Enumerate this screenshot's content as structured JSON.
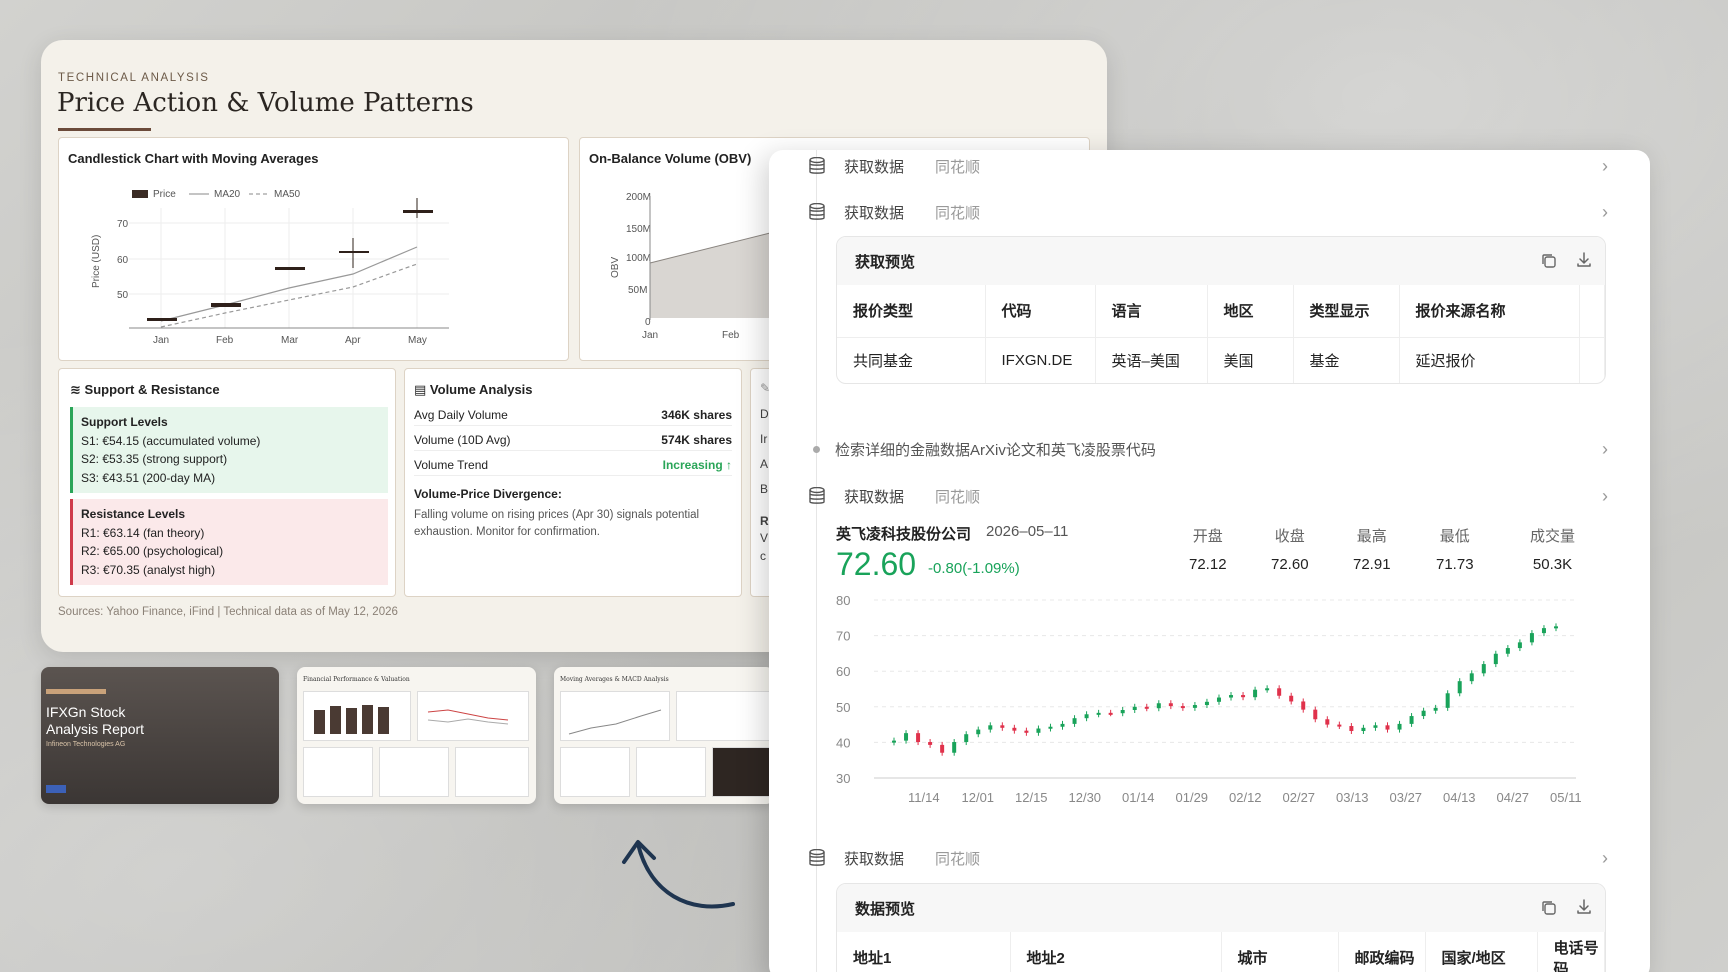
{
  "report": {
    "kicker": "TECHNICAL ANALYSIS",
    "title": "Price Action & Volume Patterns",
    "candle_title": "Candlestick Chart with Moving Averages",
    "obv_title": "On-Balance Volume (OBV)",
    "legend": [
      "Price",
      "MA20",
      "MA50"
    ],
    "candle_ylabel": "Price (USD)",
    "candle_yticks": [
      "70",
      "60",
      "50"
    ],
    "candle_xticks": [
      "Jan",
      "Feb",
      "Mar",
      "Apr",
      "May"
    ],
    "obv_ylabel": "OBV",
    "obv_yticks": [
      "200M",
      "150M",
      "100M",
      "50M",
      "0"
    ],
    "obv_xticks": [
      "Jan",
      "Feb"
    ],
    "sr": {
      "title": "Support & Resistance",
      "support_head": "Support Levels",
      "support": [
        "S1: €54.15 (accumulated volume)",
        "S2: €53.35 (strong support)",
        "S3: €43.51 (200-day MA)"
      ],
      "resist_head": "Resistance Levels",
      "resist": [
        "R1: €63.14 (fan theory)",
        "R2: €65.00 (psychological)",
        "R3: €70.35 (analyst high)"
      ]
    },
    "vol": {
      "title": "Volume Analysis",
      "rows": [
        {
          "k": "Avg Daily Volume",
          "v": "346K shares"
        },
        {
          "k": "Volume (10D Avg)",
          "v": "574K shares"
        },
        {
          "k": "Volume Trend",
          "v": "Increasing ↑"
        }
      ],
      "div_title": "Volume-Price Divergence:",
      "div_text": "Falling volume on rising prices (Apr 30) signals potential exhaustion. Monitor for confirmation."
    },
    "extra_letters": [
      "D",
      "Ir",
      "A",
      "B",
      "R",
      "V",
      "c"
    ],
    "sources": "Sources: Yahoo Finance, iFind | Technical data as of May 12, 2026"
  },
  "thumbs": {
    "t1_title": "IFXGn Stock Analysis Report",
    "t1_sub": "Infineon Technologies AG",
    "t2_title": "Financial Performance & Valuation",
    "t3_title": "Moving Averages & MACD Analysis"
  },
  "right": {
    "steps": [
      {
        "label": "获取数据",
        "source": "同花顺"
      },
      {
        "label": "获取数据",
        "source": "同花顺"
      },
      {
        "label": "获取数据",
        "source": "同花顺"
      },
      {
        "label": "获取数据",
        "source": "同花顺"
      }
    ],
    "bullet": "检索详细的金融数据ArXiv论文和英飞凌股票代码",
    "preview1": {
      "title": "获取预览",
      "headers": [
        "报价类型",
        "代码",
        "语言",
        "地区",
        "类型显示",
        "报价来源名称"
      ],
      "row": [
        "共同基金",
        "IFXGN.DE",
        "英语–美国",
        "美国",
        "基金",
        "延迟报价"
      ]
    },
    "stock": {
      "name": "英飞凌科技股份公司",
      "date": "2026–05–11",
      "price": "72.60",
      "change": "-0.80(-1.09%)",
      "stats": [
        {
          "k": "开盘",
          "v": "72.12"
        },
        {
          "k": "收盘",
          "v": "72.60"
        },
        {
          "k": "最高",
          "v": "72.91"
        },
        {
          "k": "最低",
          "v": "71.73"
        },
        {
          "k": "成交量",
          "v": "50.3K"
        }
      ]
    },
    "preview2": {
      "title": "数据预览",
      "headers": [
        "地址1",
        "地址2",
        "城市",
        "邮政编码",
        "国家/地区",
        "电话号码"
      ]
    },
    "colors": {
      "up": "#19a35a",
      "down": "#e0314b",
      "accent": "#19a35a"
    }
  },
  "chart_data": {
    "type": "line",
    "yticks": [
      30,
      40,
      50,
      60,
      70,
      80
    ],
    "ylim": [
      30,
      80
    ],
    "x": [
      "11/14",
      "12/01",
      "12/15",
      "12/30",
      "01/14",
      "01/29",
      "02/12",
      "02/27",
      "03/13",
      "03/27",
      "04/13",
      "04/27",
      "05/11"
    ],
    "series": [
      {
        "values": [
          40.5,
          42.6,
          40.1,
          39.3,
          37.1,
          40.1,
          42.3,
          43.6,
          44.8,
          44.1,
          43.3,
          42.7,
          43.9,
          44.4,
          45.2,
          46.8,
          47.9,
          48.3,
          48.2,
          49.1,
          50.0,
          49.6,
          51.0,
          50.2,
          49.7,
          50.5,
          51.4,
          52.6,
          53.3,
          52.7,
          54.8,
          55.2,
          53.1,
          51.5,
          49.2,
          46.5,
          45.0,
          44.6,
          43.2,
          44.1,
          44.8,
          43.6,
          45.2,
          47.4,
          48.9,
          49.7,
          53.8,
          57.2,
          59.4,
          62.0,
          64.9,
          66.5,
          68.1,
          70.7,
          72.1,
          72.6
        ]
      }
    ]
  }
}
